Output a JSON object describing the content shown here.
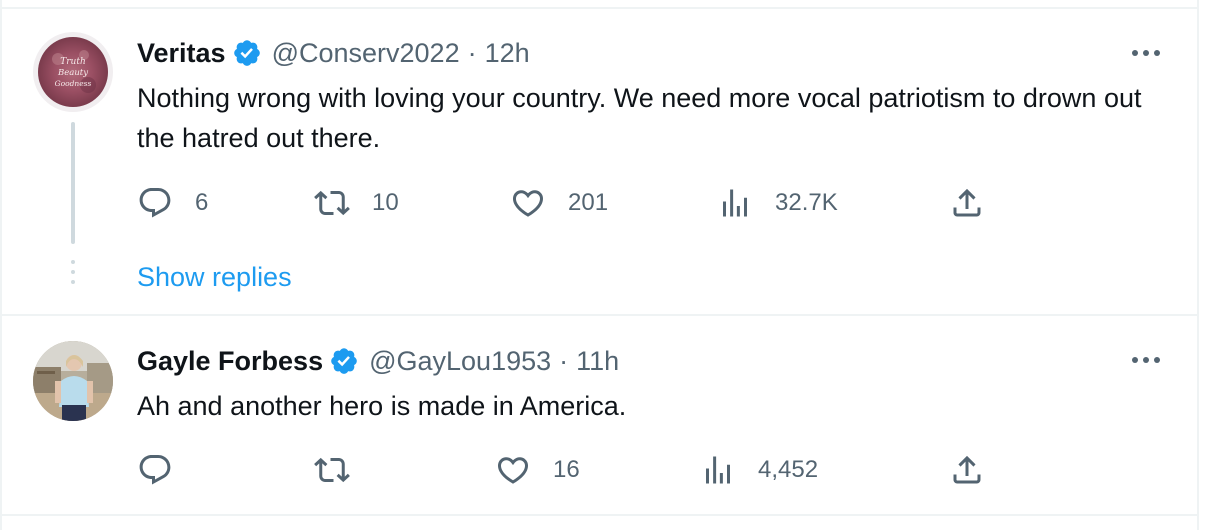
{
  "tweets": [
    {
      "name": "Veritas",
      "handle": "@Conserv2022",
      "separator": "·",
      "time": "12h",
      "avatar_text": [
        "Truth",
        "Beauty",
        "Goodness"
      ],
      "text": "Nothing wrong with loving your country. We need more vocal patriotism to drown out the hatred out there.",
      "replies": "6",
      "retweets": "10",
      "likes": "201",
      "views": "32.7K",
      "show_replies": "Show replies"
    },
    {
      "name": "Gayle Forbess",
      "handle": "@GayLou1953",
      "separator": "·",
      "time": "11h",
      "text": "Ah and another hero is made in America.",
      "replies": "",
      "retweets": "",
      "likes": "16",
      "views": "4,452"
    }
  ],
  "colors": {
    "verified": "#1d9bf0",
    "link": "#1d9bf0",
    "secondary_text": "#536471",
    "primary_text": "#0f1419",
    "divider": "#eff3f4"
  },
  "icons": [
    "verified-badge-icon",
    "more-icon",
    "reply-icon",
    "retweet-icon",
    "like-icon",
    "views-icon",
    "share-icon"
  ]
}
